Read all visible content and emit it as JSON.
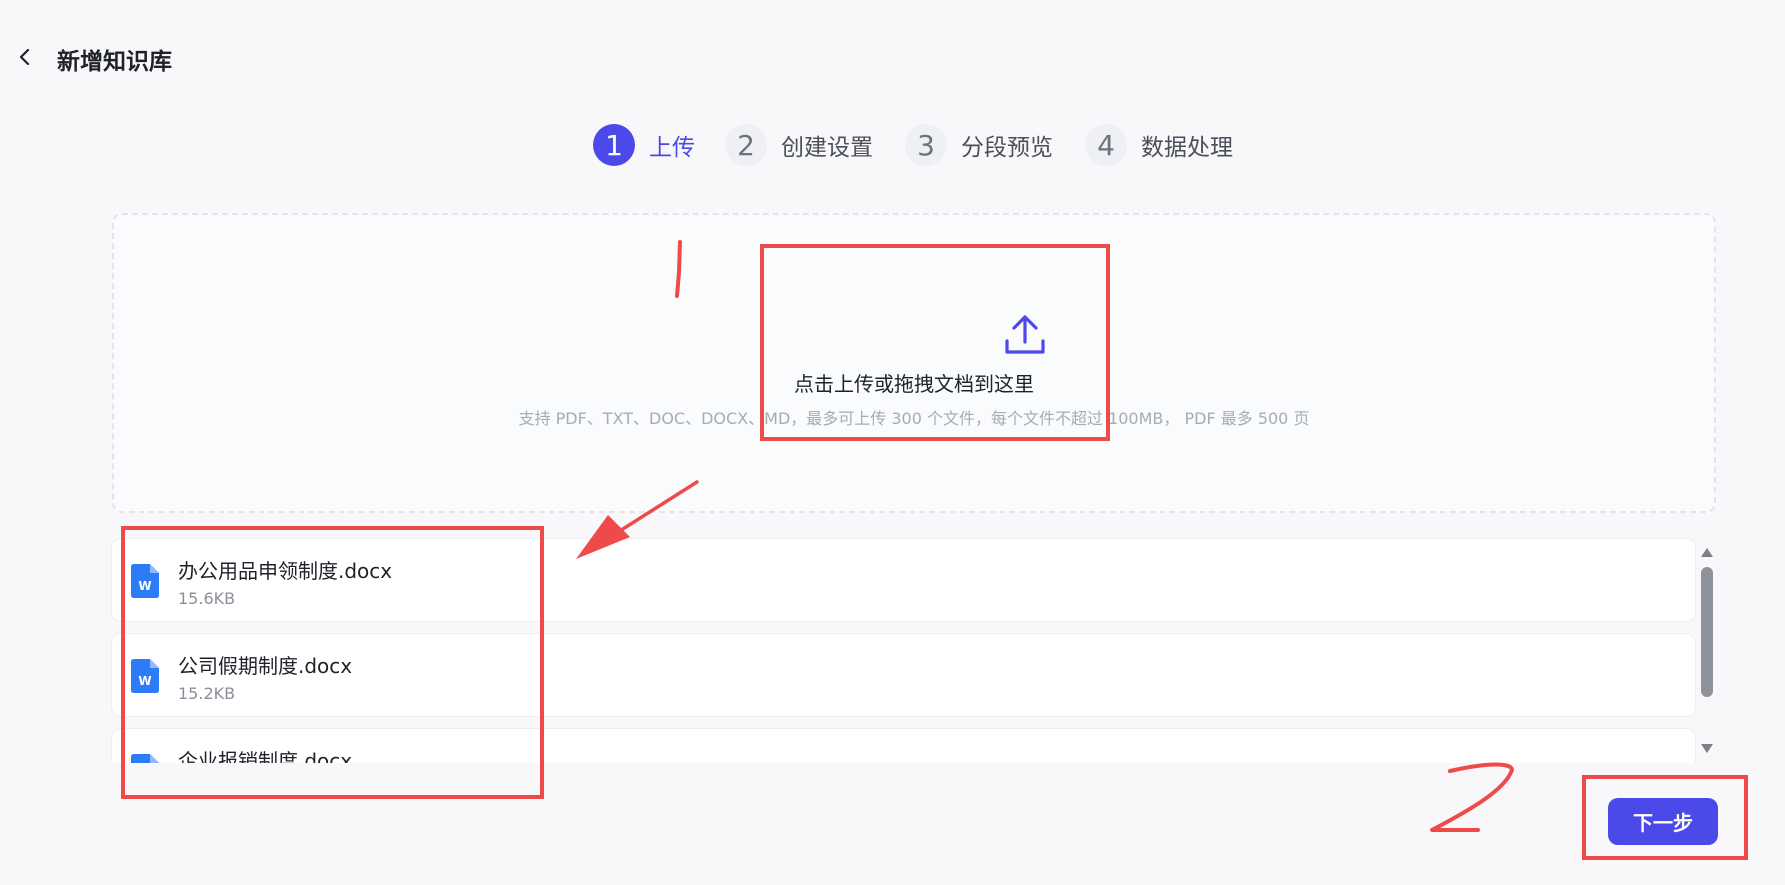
{
  "header": {
    "title": "新增知识库"
  },
  "steps": [
    {
      "num": "1",
      "label": "上传"
    },
    {
      "num": "2",
      "label": "创建设置"
    },
    {
      "num": "3",
      "label": "分段预览"
    },
    {
      "num": "4",
      "label": "数据处理"
    }
  ],
  "upload": {
    "main_text": "点击上传或拖拽文档到这里",
    "hint_text": "支持 PDF、TXT、DOC、DOCX、MD，最多可上传 300 个文件，每个文件不超过 100MB， PDF 最多 500 页"
  },
  "files": [
    {
      "name": "办公用品申领制度.docx",
      "size": "15.6KB",
      "icon": "word-file-icon",
      "icon_letter": "W"
    },
    {
      "name": "公司假期制度.docx",
      "size": "15.2KB",
      "icon": "word-file-icon",
      "icon_letter": "W"
    },
    {
      "name": "企业报销制度.docx",
      "size": "",
      "icon": "word-file-icon",
      "icon_letter": "W"
    }
  ],
  "footer": {
    "next_label": "下一步"
  },
  "colors": {
    "accent": "#4b49e8",
    "annotation": "#ef4a4a",
    "word_icon": "#2b7cf6",
    "background": "#f8f8fb"
  }
}
